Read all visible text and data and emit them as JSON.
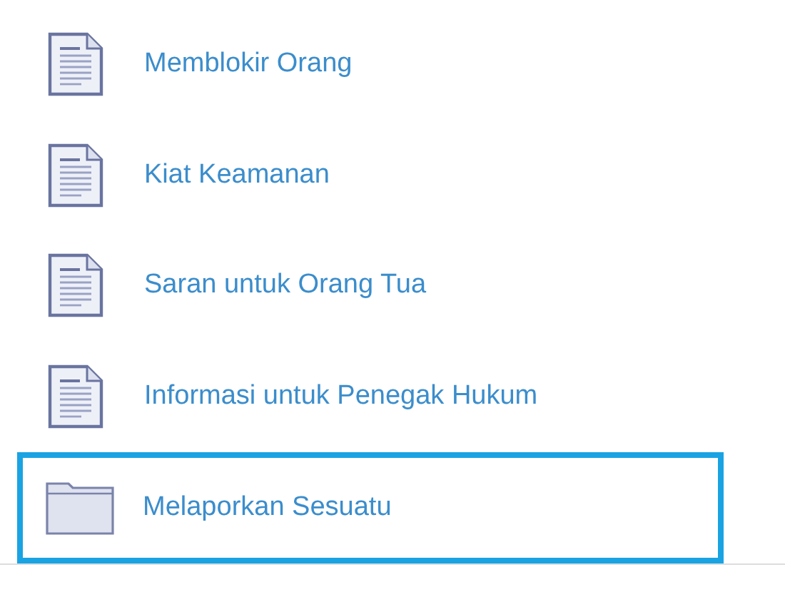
{
  "items": [
    {
      "label": "Memblokir Orang",
      "kind": "document",
      "selected": false
    },
    {
      "label": "Kiat Keamanan",
      "kind": "document",
      "selected": false
    },
    {
      "label": "Saran untuk Orang Tua",
      "kind": "document",
      "selected": false
    },
    {
      "label": "Informasi untuk Penegak Hukum",
      "kind": "document",
      "selected": false
    },
    {
      "label": "Melaporkan Sesuatu",
      "kind": "folder",
      "selected": true
    }
  ]
}
